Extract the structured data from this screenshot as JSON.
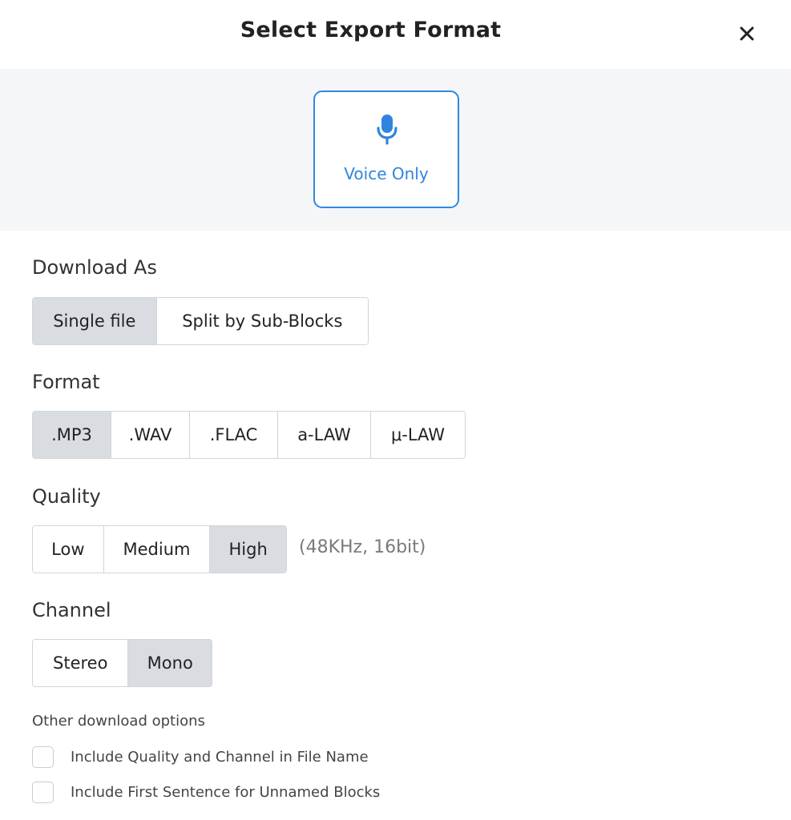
{
  "dialog": {
    "title": "Select Export Format",
    "close_icon": "close-icon"
  },
  "source": {
    "icon": "microphone-icon",
    "label": "Voice Only",
    "accent_color": "#2f88e4"
  },
  "download_as": {
    "label": "Download As",
    "options": [
      "Single file",
      "Split by Sub-Blocks"
    ],
    "selected": "Single file"
  },
  "format": {
    "label": "Format",
    "options": [
      ".MP3",
      ".WAV",
      ".FLAC",
      "a-LAW",
      "μ-LAW"
    ],
    "selected": ".MP3"
  },
  "quality": {
    "label": "Quality",
    "options": [
      "Low",
      "Medium",
      "High"
    ],
    "selected": "High",
    "note": "(48KHz, 16bit)"
  },
  "channel": {
    "label": "Channel",
    "options": [
      "Stereo",
      "Mono"
    ],
    "selected": "Mono"
  },
  "other_options": {
    "label": "Other download options",
    "items": [
      {
        "label": "Include Quality and Channel in File Name",
        "checked": false
      },
      {
        "label": "Include First Sentence for Unnamed Blocks",
        "checked": false
      }
    ]
  },
  "colors": {
    "selected_segment_bg": "#d9dde2",
    "panel_bg": "#f5f6f8"
  }
}
